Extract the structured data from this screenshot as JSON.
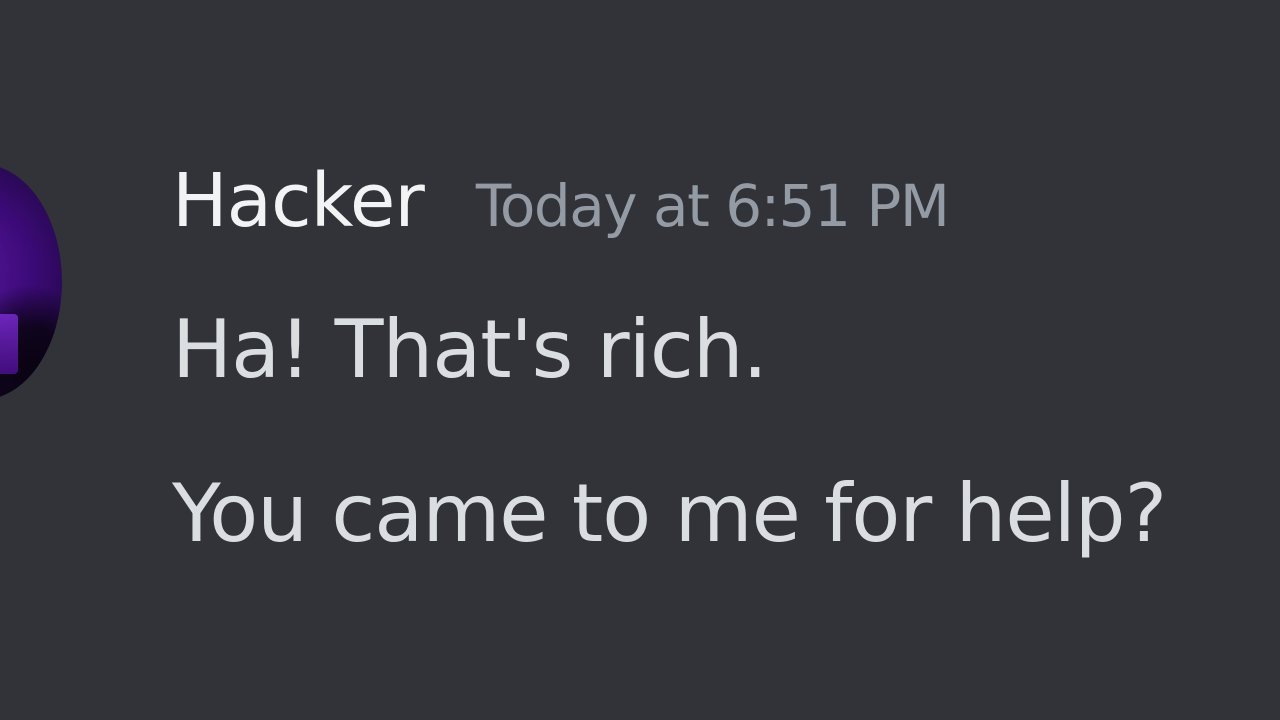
{
  "message": {
    "author": "Hacker",
    "timestamp": "Today at 6:51 PM",
    "lines": [
      "Ha! That's rich.",
      "You came to me for help?"
    ]
  },
  "avatar": {
    "icon": "user-avatar",
    "accent": "#4b0f8f"
  },
  "colors": {
    "background": "#313338",
    "username": "#f2f3f5",
    "timestamp": "#949ba4",
    "text": "#dbdee1"
  }
}
